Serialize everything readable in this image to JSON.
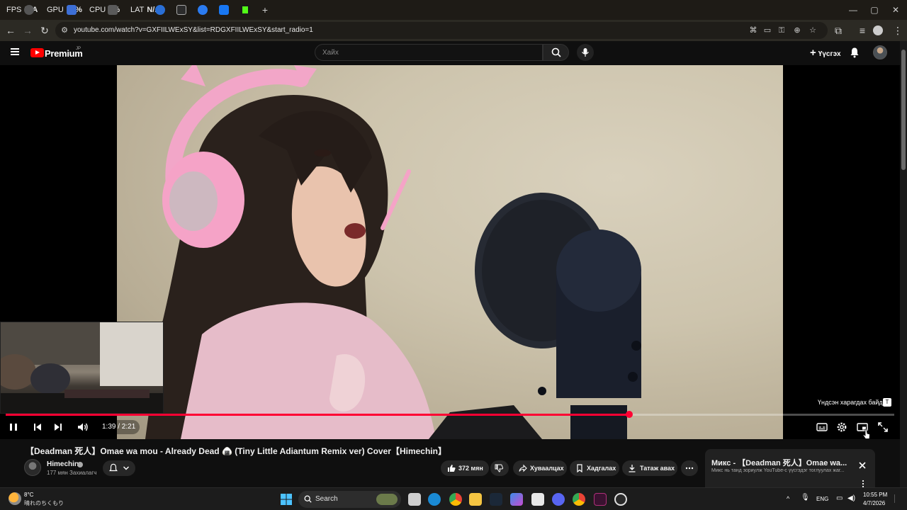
{
  "overlay": {
    "fps_label": "FPS",
    "fps_value": "N/A",
    "gpu_label": "GPU",
    "gpu_value": "28%",
    "cpu_label": "CPU",
    "cpu_value": "9%",
    "lat_label": "LAT",
    "lat_value": "N/A"
  },
  "browser": {
    "new_tab": "+",
    "url": "youtube.com/watch?v=GXFIILWExSY&list=RDGXFIILWExSY&start_radio=1"
  },
  "youtube": {
    "brand": "Premium",
    "brand_region": "JP",
    "search_placeholder": "Хайх",
    "create_label": "Үүсгэх"
  },
  "player": {
    "time": "1:39 / 2:21",
    "progress_fraction": 0.702,
    "ambient_note": "Үндсэн харагдах байдал",
    "ambient_toggle": "T"
  },
  "video": {
    "title": "【Deadman 死人】Omae wa mou - Already Dead 🍙 (Tiny Little Adiantum Remix ver) Cover【Himechin】",
    "channel": "Himechin",
    "subscribers": "177 мян Захиалагч",
    "likes": "372 мян",
    "share": "Хуваалцах",
    "save": "Хадгалах",
    "download": "Татаж авах"
  },
  "mix": {
    "title": "Микс - 【Deadman 死人】Omae wa...",
    "desc": "Микс нь танд зориулж YouTube-с үүсгэдэг тоглуулах жаг..."
  },
  "taskbar": {
    "temp": "8°C",
    "weather": "晴れのちくもり",
    "search_label": "Search",
    "lang": "ENG",
    "time": "10:55 PM",
    "date": "4/7/2026"
  },
  "colors": {
    "accent": "#ff0033",
    "bg": "#0f0f0f",
    "chip": "#272727"
  }
}
